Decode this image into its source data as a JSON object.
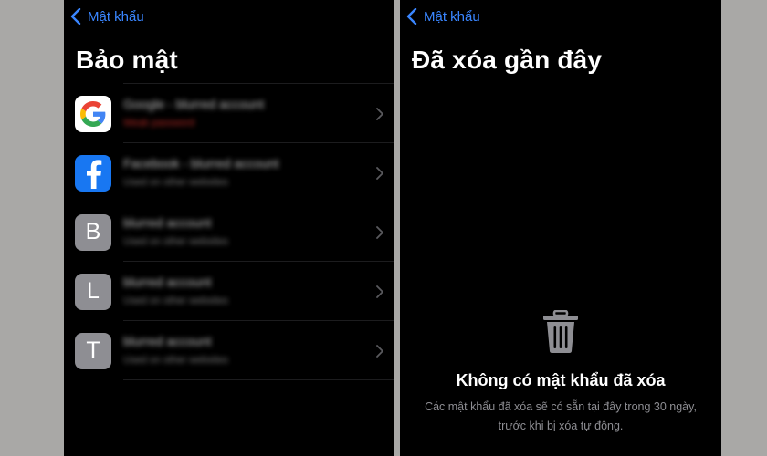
{
  "left_screen": {
    "back_label": "Mật khẩu",
    "title": "Bảo mật",
    "items": [
      {
        "icon": "google-logo",
        "title": "Google - blurred account",
        "subtitle": "Weak password",
        "subtitle_color": "#d0302a"
      },
      {
        "icon": "facebook-logo",
        "title": "Facebook - blurred account",
        "subtitle": "Used on other websites"
      },
      {
        "icon": "letter",
        "letter": "B",
        "title": "blurred account",
        "subtitle": "Used on other websites"
      },
      {
        "icon": "letter",
        "letter": "L",
        "title": "blurred account",
        "subtitle": "Used on other websites"
      },
      {
        "icon": "letter",
        "letter": "T",
        "title": "blurred account",
        "subtitle": "Used on other websites"
      }
    ]
  },
  "right_screen": {
    "back_label": "Mật khẩu",
    "title": "Đã xóa gần đây",
    "empty_icon": "trash-icon",
    "empty_title": "Không có mật khẩu đã xóa",
    "empty_description": "Các mật khẩu đã xóa sẽ có sẵn tại đây trong 30 ngày, trước khi bị xóa tự động."
  },
  "colors": {
    "accent": "#3a86ff",
    "background": "#000000",
    "outer_background": "#a9a8a6",
    "secondary_text": "#8e8e93"
  }
}
